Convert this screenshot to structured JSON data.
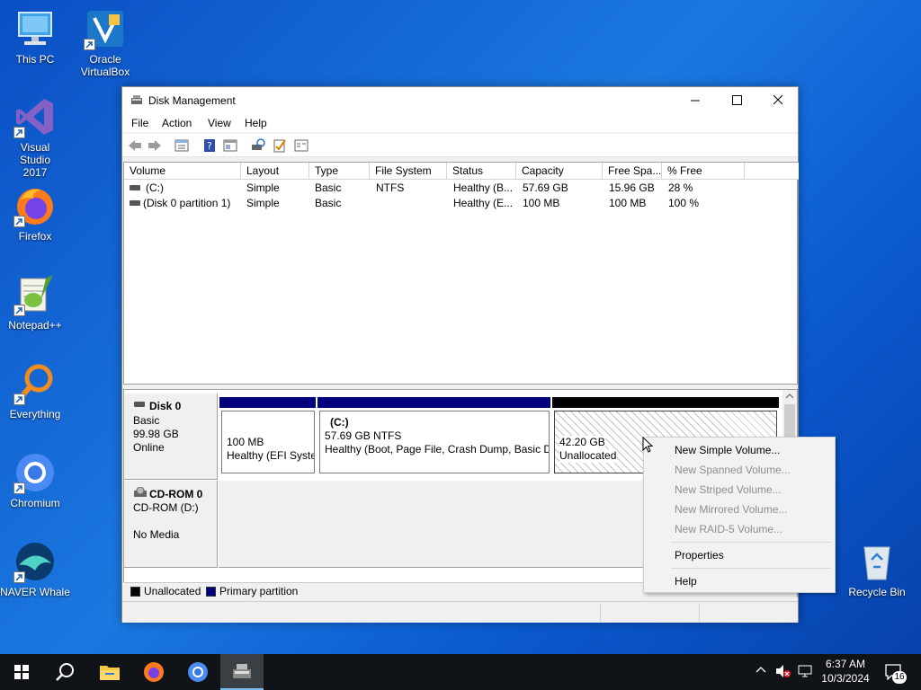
{
  "desktop": {
    "icons": [
      {
        "label": "This PC"
      },
      {
        "label": "Oracle VirtualBox"
      },
      {
        "label": "Visual Studio 2017"
      },
      {
        "label": "Firefox"
      },
      {
        "label": "Notepad++"
      },
      {
        "label": "Everything"
      },
      {
        "label": "Chromium"
      },
      {
        "label": "NAVER Whale"
      },
      {
        "label": "Recycle Bin"
      }
    ]
  },
  "window": {
    "title": "Disk Management",
    "menu": [
      "File",
      "Action",
      "View",
      "Help"
    ],
    "toolbar_icons": [
      "back-arrow-icon",
      "forward-arrow-icon",
      "properties-icon",
      "help-icon",
      "view-icon",
      "rescan-icon",
      "check-icon",
      "list-icon"
    ]
  },
  "volume_table": {
    "columns": [
      "Volume",
      "Layout",
      "Type",
      "File System",
      "Status",
      "Capacity",
      "Free Spa...",
      "% Free"
    ],
    "rows": [
      [
        "(C:)",
        "Simple",
        "Basic",
        "NTFS",
        "Healthy (B...",
        "57.69 GB",
        "15.96 GB",
        "28 %"
      ],
      [
        "(Disk 0 partition 1)",
        "Simple",
        "Basic",
        "",
        "Healthy (E...",
        "100 MB",
        "100 MB",
        "100 %"
      ]
    ]
  },
  "disks": {
    "disk0": {
      "name": "Disk 0",
      "type": "Basic",
      "size": "99.98 GB",
      "state": "Online",
      "partitions": [
        {
          "title": "",
          "size": "100 MB",
          "status": "Healthy (EFI Syste"
        },
        {
          "title": "(C:)",
          "size": "57.69 GB NTFS",
          "status": "Healthy (Boot, Page File, Crash Dump, Basic Da"
        },
        {
          "title": "",
          "size": "42.20 GB",
          "status": "Unallocated"
        }
      ]
    },
    "cdrom0": {
      "name": "CD-ROM 0",
      "drive": "CD-ROM (D:)",
      "media": "No Media"
    }
  },
  "legend": {
    "unallocated": "Unallocated",
    "primary": "Primary partition",
    "unallocated_color": "#000000",
    "primary_color": "#00007f"
  },
  "context_menu": {
    "items": [
      {
        "label": "New Simple Volume...",
        "enabled": true
      },
      {
        "label": "New Spanned Volume...",
        "enabled": false
      },
      {
        "label": "New Striped Volume...",
        "enabled": false
      },
      {
        "label": "New Mirrored Volume...",
        "enabled": false
      },
      {
        "label": "New RAID-5 Volume...",
        "enabled": false
      },
      {
        "label": "Properties",
        "enabled": true
      },
      {
        "label": "Help",
        "enabled": true
      }
    ]
  },
  "taskbar": {
    "time": "6:37 AM",
    "date": "10/3/2024",
    "notification_count": "16",
    "apps": [
      "start-icon",
      "search-icon",
      "file-explorer-icon",
      "firefox-icon",
      "chromium-icon",
      "disk-management-icon"
    ]
  }
}
